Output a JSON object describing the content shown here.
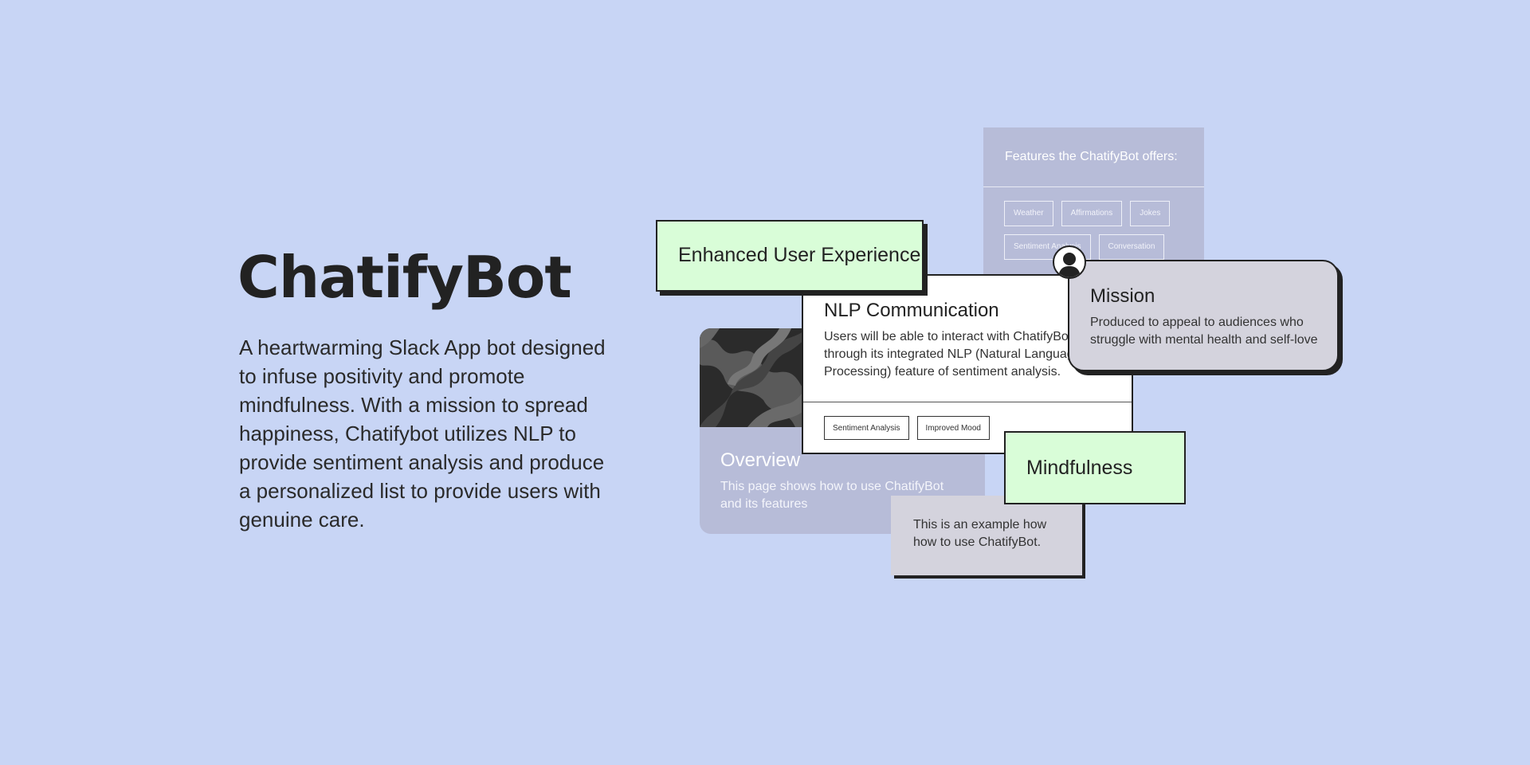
{
  "hero": {
    "title": "ChatifyBot",
    "description": " A heartwarming Slack App bot designed to infuse positivity and promote mindfulness. With a mission to spread happiness, Chatifybot utilizes NLP to provide sentiment analysis and produce a personalized list to provide users with genuine care."
  },
  "features": {
    "title": "Features the ChatifyBot offers:",
    "tags": [
      "Weather",
      "Affirmations",
      "Jokes",
      "Sentiment Analysis",
      "Conversation"
    ]
  },
  "enhanced_ux": {
    "label": "Enhanced User Experience"
  },
  "nlp": {
    "title": "NLP Communication",
    "text": "Users will be able to interact with ChatifyBot through its integrated NLP (Natural Language Processing) feature of sentiment analysis.",
    "tags": [
      "Sentiment Analysis",
      "Improved Mood"
    ]
  },
  "overview": {
    "title": "Overview",
    "text": "This page shows how to use ChatifyBot and its features"
  },
  "mission": {
    "title": "Mission",
    "text": "Produced to appeal to audiences who struggle with mental health and self-love"
  },
  "mindfulness": {
    "label": "Mindfulness"
  },
  "example": {
    "text": "This is an example how how to use ChatifyBot."
  },
  "colors": {
    "background": "#c8d5f5",
    "green_card": "#d9fdd8",
    "lavender_card": "#b7bcd8",
    "gray_card": "#d4d3dd",
    "ink": "#222222"
  }
}
